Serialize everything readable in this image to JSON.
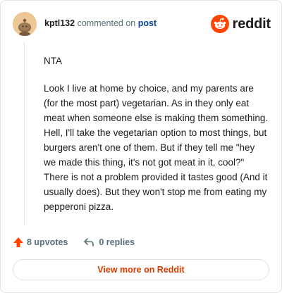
{
  "header": {
    "username": "kptl132",
    "action_text": "commented on",
    "post_link": "post",
    "brand": "reddit"
  },
  "comment": {
    "paragraphs": [
      "NTA",
      "Look I live at home by choice, and my parents are (for the most part) vegetarian. As in they only eat meat when someone else is making them something. Hell, I'll take the vegetarian option to most things, but burgers aren't one of them. But if they tell me \"hey we made this thing, it's not got meat in it, cool?\" There is not a problem provided it tastes good (And it usually does). But they won't stop me from eating my pepperoni pizza."
    ]
  },
  "footer": {
    "upvotes_label": "8 upvotes",
    "replies_label": "0 replies",
    "view_more_label": "View more on Reddit"
  },
  "colors": {
    "accent": "#d93a00",
    "upvote": "#ff4500",
    "link": "#0a449b",
    "muted": "#576f76"
  },
  "icons": {
    "avatar": "snoo-avatar",
    "brand": "reddit-logo-icon",
    "upvote": "upvote-arrow-icon",
    "reply": "reply-arrow-icon"
  }
}
